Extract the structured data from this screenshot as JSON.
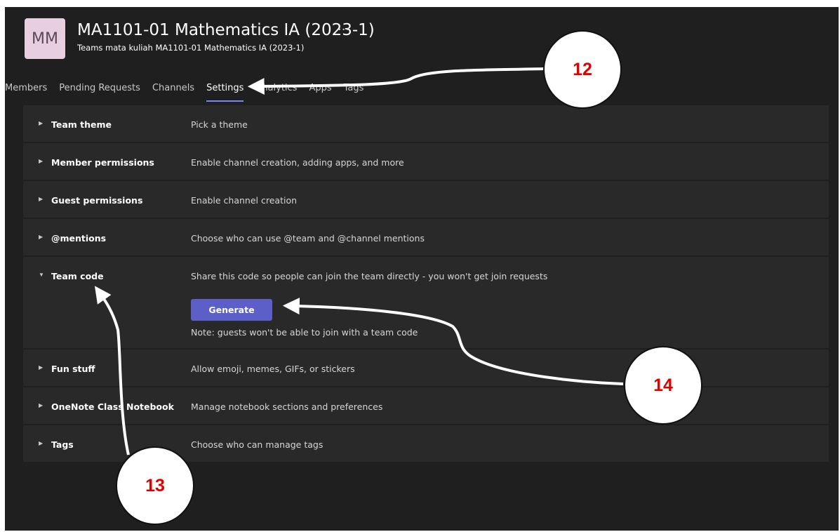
{
  "team": {
    "avatar_initials": "MM",
    "title": "MA1101-01 Mathematics IA (2023-1)",
    "more": "···",
    "subtitle": "Teams mata kuliah MA1101-01 Mathematics IA (2023-1)"
  },
  "tabs": [
    {
      "label": "Members"
    },
    {
      "label": "Pending Requests"
    },
    {
      "label": "Channels"
    },
    {
      "label": "Settings",
      "active": true
    },
    {
      "label": "Analytics"
    },
    {
      "label": "Apps"
    },
    {
      "label": "Tags"
    }
  ],
  "settings": [
    {
      "title": "Team theme",
      "desc": "Pick a theme"
    },
    {
      "title": "Member permissions",
      "desc": "Enable channel creation, adding apps, and more"
    },
    {
      "title": "Guest permissions",
      "desc": "Enable channel creation"
    },
    {
      "title": "@mentions",
      "desc": "Choose who can use @team and @channel mentions"
    },
    {
      "title": "Team code",
      "desc": "Share this code so people can join the team directly - you won't get join requests",
      "expanded": true
    },
    {
      "title": "Fun stuff",
      "desc": "Allow emoji, memes, GIFs, or stickers"
    },
    {
      "title": "OneNote Class Notebook",
      "desc": "Manage notebook sections and preferences"
    },
    {
      "title": "Tags",
      "desc": "Choose who can manage tags"
    }
  ],
  "team_code": {
    "button": "Generate",
    "note": "Note: guests won't be able to join with a team code"
  },
  "annotations": {
    "a12": "12",
    "a13": "13",
    "a14": "14"
  },
  "colors": {
    "background": "#1f1f1f",
    "row": "#292929",
    "accent": "#5b5fc7",
    "active_tab_underline": "#7f85f5",
    "badge_text": "#e00000"
  }
}
